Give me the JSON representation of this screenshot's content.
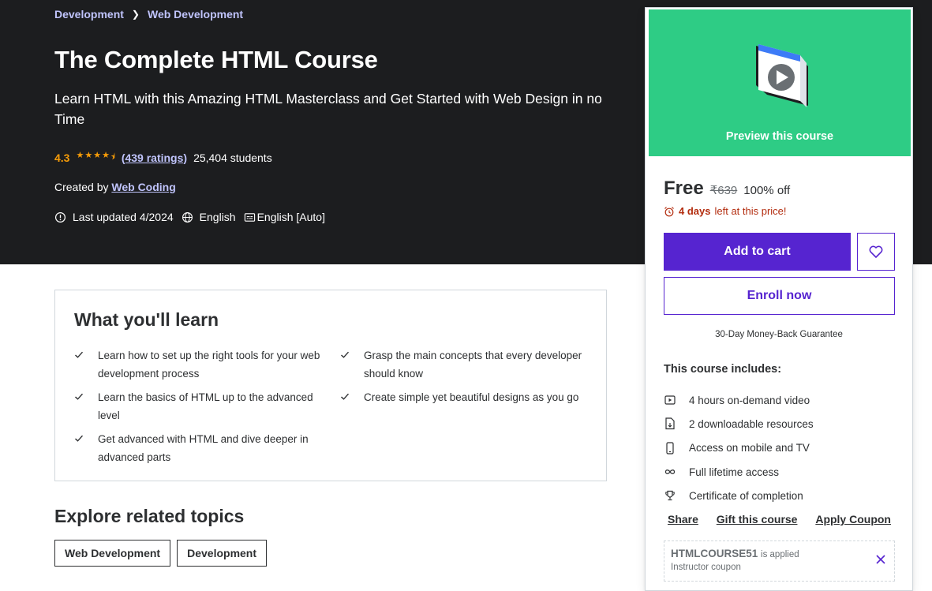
{
  "breadcrumb": [
    "Development",
    "Web Development"
  ],
  "course": {
    "title": "The Complete HTML Course",
    "subtitle": "Learn HTML with this Amazing HTML Masterclass and Get Started with Web Design in no Time",
    "rating": "4.3",
    "rating_value": 4.3,
    "rating_count": "(439 ratings)",
    "students": "25,404 students",
    "created_by_label": "Created by",
    "instructor": "Web Coding",
    "last_updated": "Last updated 4/2024",
    "language": "English",
    "captions": "English [Auto]"
  },
  "sidebar": {
    "preview_label": "Preview this course",
    "price": "Free",
    "original_price": "₹639",
    "discount": "100% off",
    "timer_bold": "4 days",
    "timer_rest": "left at this price!",
    "add_to_cart": "Add to cart",
    "enroll": "Enroll now",
    "guarantee": "30-Day Money-Back Guarantee",
    "includes_title": "This course includes:",
    "includes": [
      {
        "icon": "video-icon",
        "text": "4 hours on-demand video"
      },
      {
        "icon": "download-file-icon",
        "text": "2 downloadable resources"
      },
      {
        "icon": "mobile-icon",
        "text": "Access on mobile and TV"
      },
      {
        "icon": "infinity-icon",
        "text": "Full lifetime access"
      },
      {
        "icon": "trophy-icon",
        "text": "Certificate of completion"
      }
    ],
    "links": {
      "share": "Share",
      "gift": "Gift this course",
      "coupon": "Apply Coupon"
    },
    "coupon": {
      "code": "HTMLCOURSE51",
      "applied": "is applied",
      "kind": "Instructor coupon"
    },
    "colors": {
      "primary": "#5624d0",
      "preview_bg": "#2ecc85",
      "alert": "#b32d0f"
    }
  },
  "learn": {
    "title": "What you'll learn",
    "items": [
      "Learn how to set up the right tools for your web development process",
      "Grasp the main concepts that every developer should know",
      "Learn the basics of HTML up to the advanced level",
      "Create simple yet beautiful designs as you go",
      "Get advanced with HTML and dive deeper in advanced parts"
    ]
  },
  "topics": {
    "title": "Explore related topics",
    "items": [
      "Web Development",
      "Development"
    ]
  }
}
